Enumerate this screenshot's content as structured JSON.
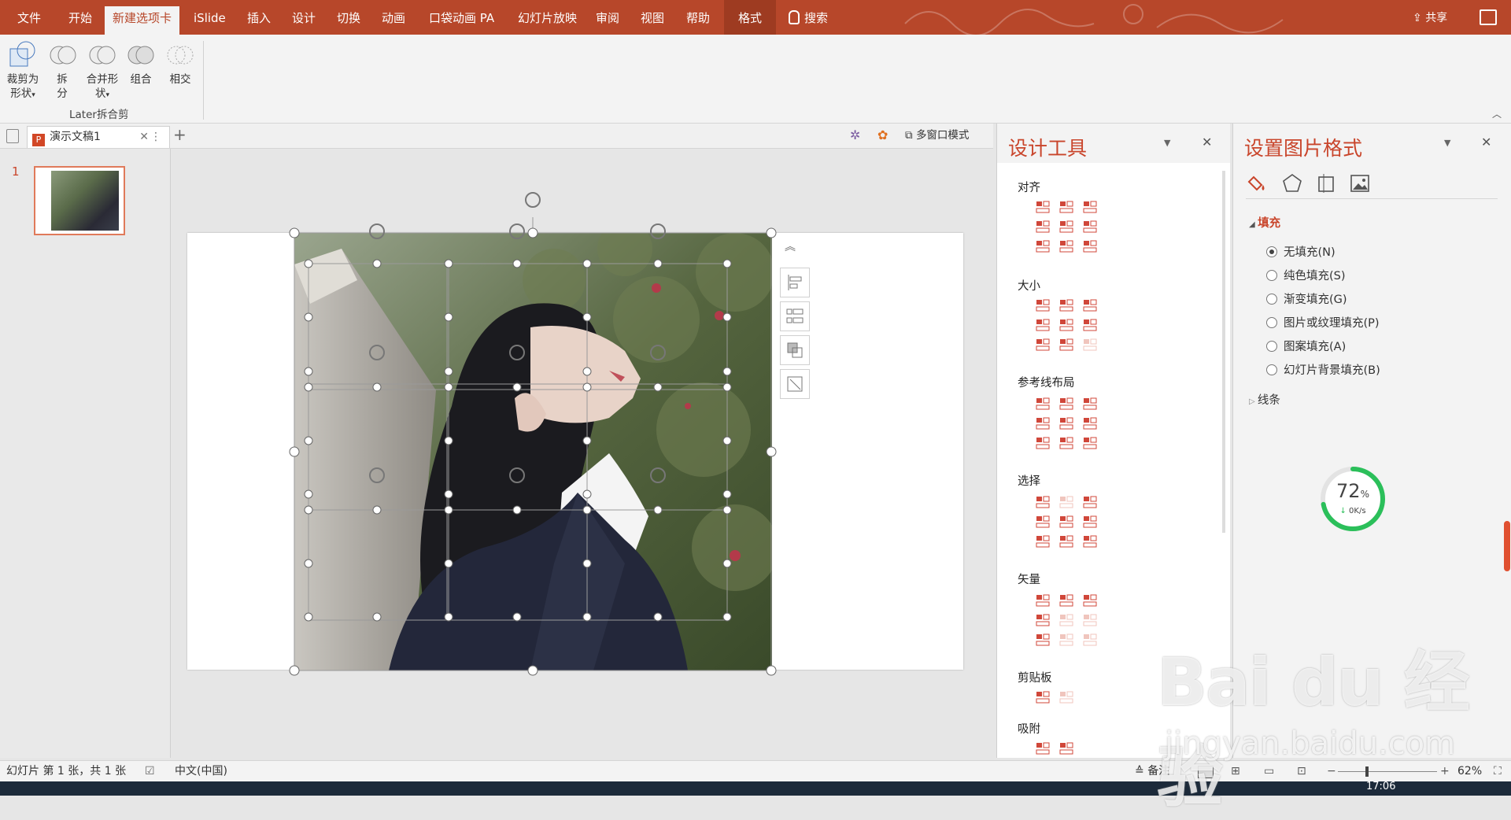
{
  "ribbon_tabs": [
    {
      "label": "文件",
      "active": false
    },
    {
      "label": "开始",
      "active": false
    },
    {
      "label": "新建选项卡",
      "active": true
    },
    {
      "label": "iSlide",
      "active": false
    },
    {
      "label": "插入",
      "active": false
    },
    {
      "label": "设计",
      "active": false
    },
    {
      "label": "切换",
      "active": false
    },
    {
      "label": "动画",
      "active": false
    },
    {
      "label": "口袋动画 PA",
      "active": false
    },
    {
      "label": "幻灯片放映",
      "active": false
    },
    {
      "label": "审阅",
      "active": false
    },
    {
      "label": "视图",
      "active": false
    },
    {
      "label": "帮助",
      "active": false
    },
    {
      "label": "格式",
      "active": false
    }
  ],
  "search_label": "搜索",
  "share_label": "共享",
  "ribbon": {
    "buttons": [
      {
        "label": "裁剪为\n形状",
        "dropdown": true
      },
      {
        "label": "拆\n分",
        "dropdown": false
      },
      {
        "label": "合并形\n状",
        "dropdown": true
      },
      {
        "label": "组合",
        "dropdown": false
      },
      {
        "label": "相交",
        "dropdown": false
      }
    ],
    "group_label": "Later拆合剪"
  },
  "doc_tab": {
    "title": "演示文稿1"
  },
  "multi_window_label": "多窗口模式",
  "slide_number": "1",
  "design_panel": {
    "title": "设计工具",
    "sections": [
      "对齐",
      "大小",
      "参考线布局",
      "选择",
      "矢量",
      "剪贴板",
      "吸附"
    ]
  },
  "format_panel": {
    "title": "设置图片格式",
    "fill_section": "填充",
    "fill_options": [
      {
        "label": "无填充(N)",
        "selected": true
      },
      {
        "label": "纯色填充(S)",
        "selected": false
      },
      {
        "label": "渐变填充(G)",
        "selected": false
      },
      {
        "label": "图片或纹理填充(P)",
        "selected": false
      },
      {
        "label": "图案填充(A)",
        "selected": false
      },
      {
        "label": "幻灯片背景填充(B)",
        "selected": false
      }
    ],
    "line_section": "线条"
  },
  "speed_widget": {
    "percent": "72",
    "percent_unit": "%",
    "rate": "0K/s",
    "progress": 0.72
  },
  "status": {
    "slide_info": "幻灯片 第 1 张，共 1 张",
    "language": "中文(中国)",
    "notes": "备注",
    "zoom": "62%"
  },
  "watermark": {
    "brand": "Bai du 经验",
    "url": "jingyan.baidu.com"
  },
  "taskbar_time": "17:06",
  "colors": {
    "accent": "#b7472a",
    "panel_title": "#c9452b",
    "icon_red": "#d0473a",
    "speed_green": "#2bbf5a"
  }
}
